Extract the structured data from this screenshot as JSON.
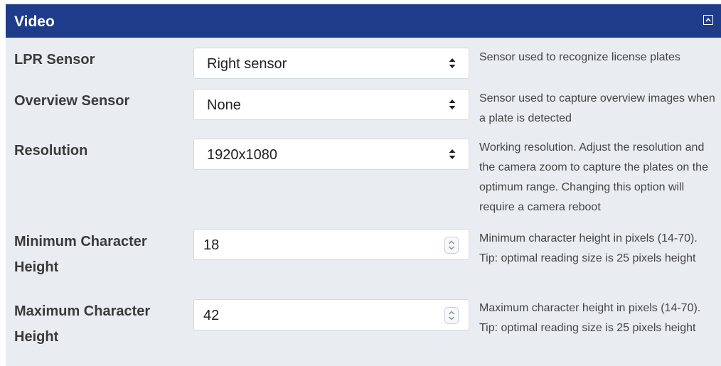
{
  "panel": {
    "title": "Video",
    "collapse_icon": "chevron-up-square-icon"
  },
  "colors": {
    "header_bg": "#1f3c8a",
    "panel_bg": "#e9edf2"
  },
  "rows": [
    {
      "label": "LPR Sensor",
      "type": "select",
      "value": "Right sensor",
      "help": "Sensor used to recognize license plates"
    },
    {
      "label": "Overview Sensor",
      "type": "select",
      "value": "None",
      "help": "Sensor used to capture overview images when a plate is detected"
    },
    {
      "label": "Resolution",
      "type": "select",
      "value": "1920x1080",
      "help": "Working resolution. Adjust the resolution and the camera zoom to capture the plates on the optimum range. Changing this option will require a camera reboot"
    },
    {
      "label": "Minimum Character Height",
      "type": "number",
      "value": "18",
      "help": "Minimum character height in pixels (14-70). Tip: optimal reading size is 25 pixels height"
    },
    {
      "label": "Maximum Character Height",
      "type": "number",
      "value": "42",
      "help": "Maximum character height in pixels (14-70). Tip: optimal reading size is 25 pixels height"
    }
  ]
}
